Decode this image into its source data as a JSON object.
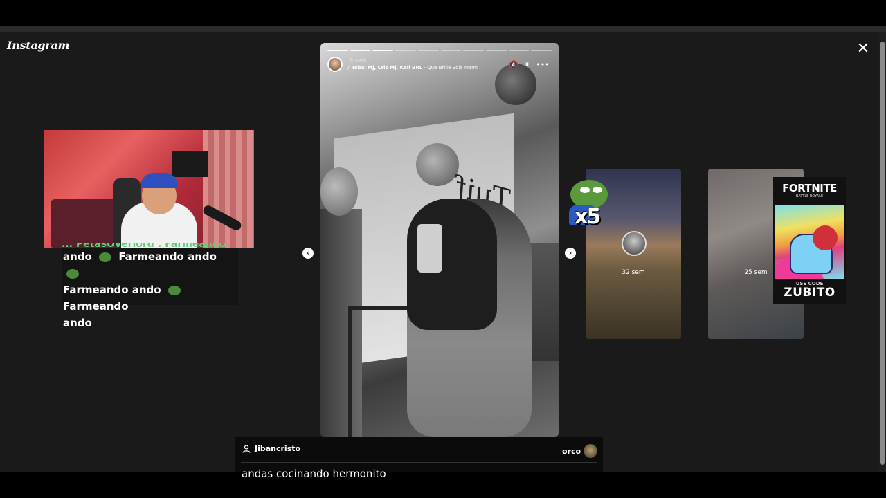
{
  "app": {
    "logo_text": "Instagram",
    "close_label": "✕"
  },
  "story": {
    "segments": 10,
    "completed": 3,
    "user": "",
    "time": "6 sem",
    "music_artists": "Tobal Mj, Cris Mj, Kali BRL",
    "music_song": "Que Brille Sola Mami",
    "wall_text": "Tuif",
    "controls": {
      "mute": "🔇",
      "pause": "⏸",
      "more": "•••"
    }
  },
  "nav": {
    "prev": "‹",
    "next": "›"
  },
  "thumbnails": [
    {
      "time": "32 sem"
    },
    {
      "time": "25 sem"
    }
  ],
  "stream_overlay": {
    "chat_top": "... PetasOverlord : Farmeando",
    "chat_lines": [
      "ando",
      "Farmeando ando",
      "Farmeando ando",
      "Farmeando",
      "ando"
    ],
    "emote_multiplier": "x5",
    "fortnite": {
      "title": "FORTNITE",
      "subtitle": "BATTLE ROYALE",
      "use_code": "USE CODE",
      "code": "ZUBITO"
    }
  },
  "reply": {
    "sender": "Jibancristo",
    "recipient": "orco",
    "message": "andas cocinando hermonito"
  }
}
